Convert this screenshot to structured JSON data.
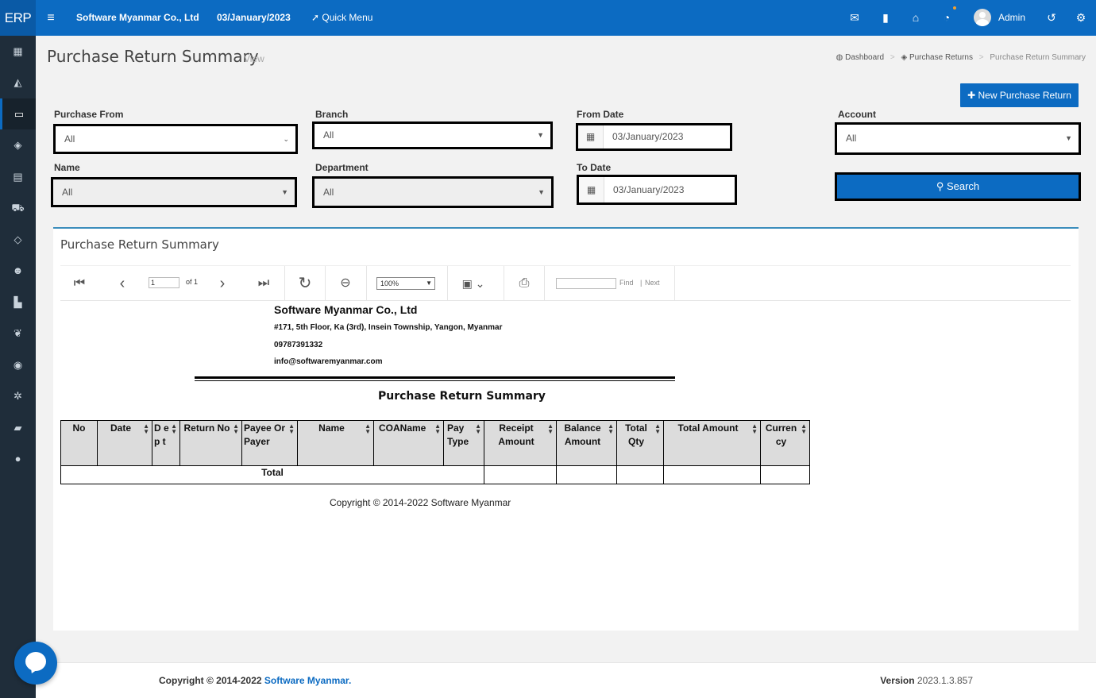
{
  "topbar": {
    "logo": "ERP",
    "company": "Software Myanmar Co., Ltd",
    "date": "03/January/2023",
    "quick_menu": "Quick Menu",
    "user": "Admin"
  },
  "page": {
    "title": "Purchase Return Summary",
    "subtitle": "View",
    "breadcrumb": [
      "Dashboard",
      "Purchase Returns",
      "Purchase Return Summary"
    ],
    "new_button": "New Purchase Return"
  },
  "filters": {
    "purchase_from": {
      "label": "Purchase From",
      "value": "All"
    },
    "branch": {
      "label": "Branch",
      "value": "All"
    },
    "from_date": {
      "label": "From Date",
      "value": "03/January/2023"
    },
    "account": {
      "label": "Account",
      "value": "All"
    },
    "name": {
      "label": "Name",
      "value": "All"
    },
    "department": {
      "label": "Department",
      "value": "All"
    },
    "to_date": {
      "label": "To Date",
      "value": "03/January/2023"
    },
    "search_button": "Search"
  },
  "report": {
    "panel_title": "Purchase Return Summary",
    "toolbar": {
      "page_value": "1",
      "of_pages": "of 1",
      "zoom": "100%",
      "find": "Find",
      "next": "Next"
    },
    "company_name": "Software Myanmar Co., Ltd",
    "address": "#171, 5th Floor, Ka (3rd), Insein Township, Yangon, Myanmar",
    "phone": "09787391332",
    "email": "info@softwaremyanmar.com",
    "title": "Purchase Return Summary",
    "columns": [
      "No",
      "Date",
      "D ep t",
      "Return No",
      "Payee Or Payer",
      "Name",
      "COAName",
      "Pay Type",
      "Receipt Amount",
      "Balance Amount",
      "Total Qty",
      "Total Amount",
      "Curren cy"
    ],
    "total_label": "Total",
    "copyright": "Copyright © 2014-2022 Software Myanmar"
  },
  "footer": {
    "copyright_prefix": "Copyright © 2014-2022",
    "brand": "Software Myanmar.",
    "version_label": "Version",
    "version": "2023.1.3.857"
  },
  "colors": {
    "primary": "#0c6bc2",
    "sidebar": "#1f2d3a"
  }
}
